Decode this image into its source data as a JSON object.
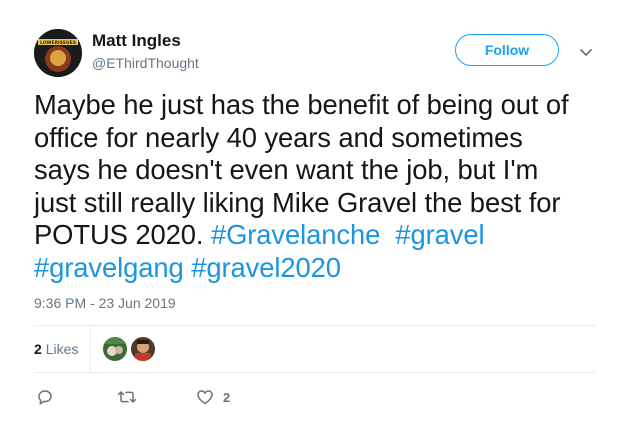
{
  "user": {
    "display_name": "Matt Ingles",
    "handle": "@EThirdThought",
    "avatar_text": "LOWERISSUES"
  },
  "follow_button": {
    "label": "Follow"
  },
  "tweet": {
    "line1": "Maybe he just has the benefit of being out of",
    "line2": "office for nearly 40 years and sometimes",
    "line3": "says he doesn't even want the job, but I'm",
    "line4": "just still really liking Mike Gravel the best for",
    "line5_text": "POTUS 2020.",
    "hashtags": [
      "#Gravelanche",
      "#gravel",
      "#gravelgang",
      "#gravel2020"
    ]
  },
  "timestamp": "9:36 PM - 23 Jun 2019",
  "likes": {
    "count": "2",
    "label": "Likes"
  },
  "actions": {
    "reply_icon": "reply-icon",
    "retweet_icon": "retweet-icon",
    "like_icon": "heart-icon",
    "like_count": "2"
  },
  "colors": {
    "accent": "#1da1f2",
    "hashtag": "#1b95e0",
    "muted": "#657786",
    "divider": "#e6ecf0"
  }
}
